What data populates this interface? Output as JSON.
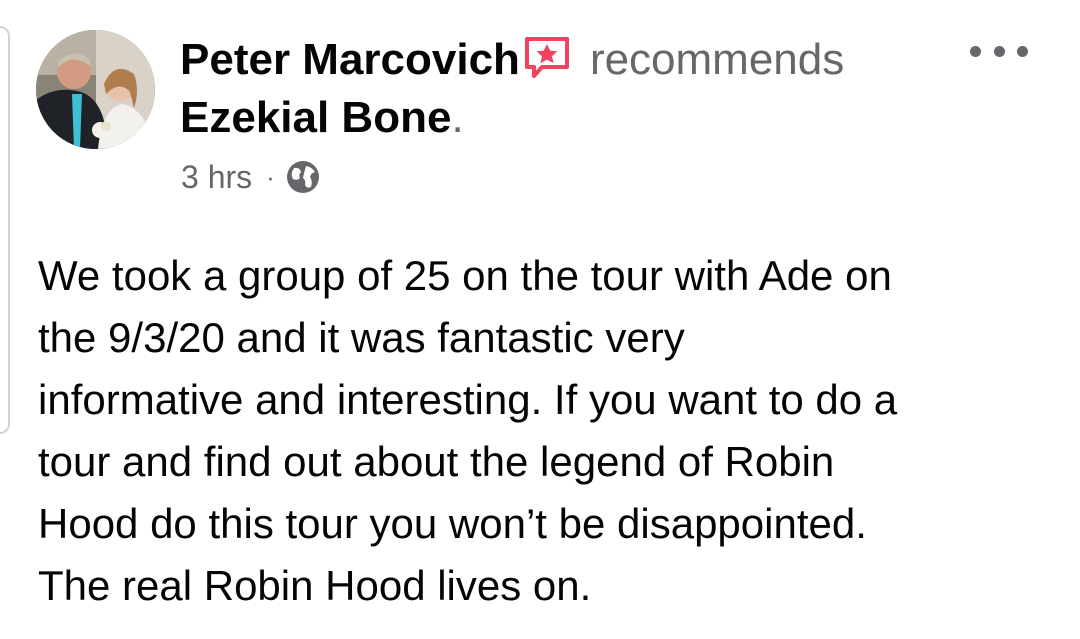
{
  "post": {
    "author": "Peter Marcovich",
    "action": "recommends",
    "page": "Ezekial Bone",
    "page_suffix": ".",
    "time": "3 hrs",
    "separator": "·",
    "privacy_icon": "globe-icon",
    "recommend_icon": "recommend-star-icon",
    "more_icon": "more-dots-icon",
    "body": "We took a group of 25 on the tour with Ade on\nthe 9/3/20 and it was fantastic very\ninformative and interesting. If you want to do a\ntour and find out about the legend of Robin\nHood do this tour you won’t be disappointed.\nThe real Robin Hood lives on."
  },
  "colors": {
    "primary_text": "#050505",
    "secondary_text": "#65676b",
    "recommend_accent": "#f3425f"
  }
}
